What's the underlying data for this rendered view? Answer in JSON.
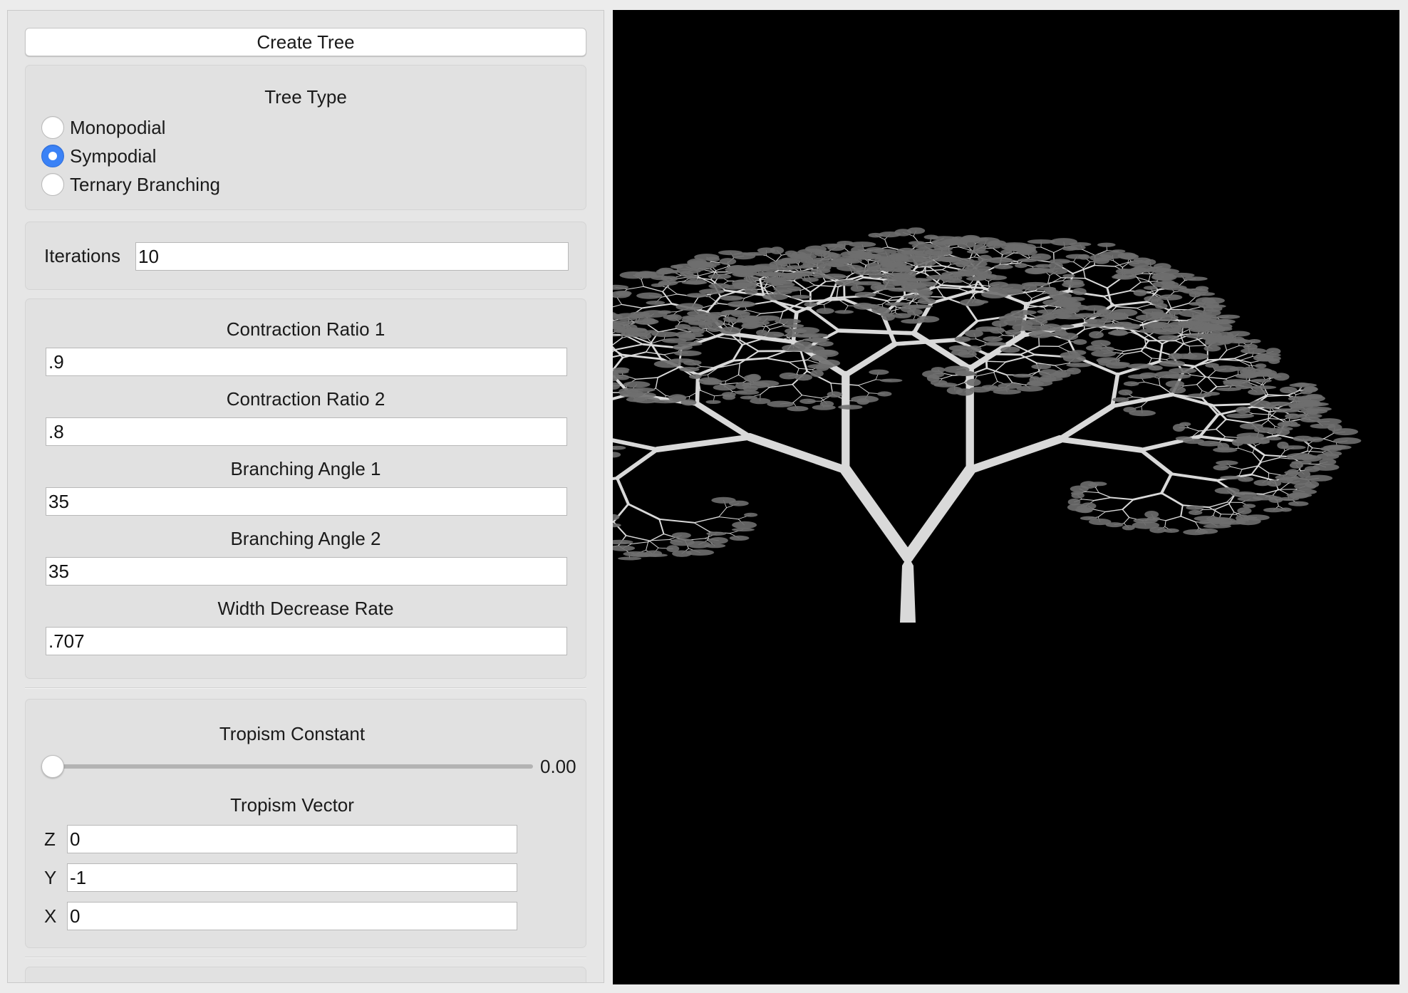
{
  "controls": {
    "create_tree_label": "Create Tree",
    "tree_type": {
      "title": "Tree Type",
      "options": [
        {
          "label": "Monopodial",
          "checked": false
        },
        {
          "label": "Sympodial",
          "checked": true
        },
        {
          "label": "Ternary Branching",
          "checked": false
        }
      ]
    },
    "iterations": {
      "label": "Iterations",
      "value": "10"
    },
    "parameters": {
      "contraction_ratio_1": {
        "label": "Contraction Ratio 1",
        "value": ".9"
      },
      "contraction_ratio_2": {
        "label": "Contraction Ratio 2",
        "value": ".8"
      },
      "branching_angle_1": {
        "label": "Branching Angle 1",
        "value": "35"
      },
      "branching_angle_2": {
        "label": "Branching Angle 2",
        "value": "35"
      },
      "width_decrease_rate": {
        "label": "Width Decrease Rate",
        "value": ".707"
      }
    },
    "tropism": {
      "constant_title": "Tropism Constant",
      "constant_value": 0,
      "constant_display": "0.00",
      "vector_title": "Tropism Vector",
      "z": {
        "label": "Z",
        "value": "0"
      },
      "y": {
        "label": "Y",
        "value": "-1"
      },
      "x": {
        "label": "X",
        "value": "0"
      }
    }
  },
  "viewport": {
    "background": "#000000",
    "branch_color": "#d9d9d9",
    "leaf_color": "#6e6e6e"
  },
  "colors": {
    "window_bg": "#ececec",
    "panel_bg": "#e6e6e6",
    "radio_checked": "#3b82f6"
  }
}
